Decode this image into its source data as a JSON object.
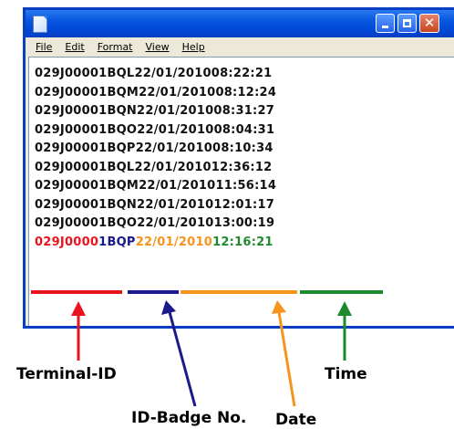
{
  "window": {
    "icon": "notepad-icon",
    "controls": [
      "minimize-icon",
      "maximize-icon",
      "close-icon"
    ]
  },
  "menu": [
    "File",
    "Edit",
    "Format",
    "View",
    "Help"
  ],
  "records": [
    "029J00001BQL22/01/201008:22:21",
    "029J00001BQM22/01/201008:12:24",
    "029J00001BQN22/01/201008:31:27",
    "029J00001BQO22/01/201008:04:31",
    "029J00001BQP22/01/201008:10:34",
    "029J00001BQL22/01/201012:36:12",
    "029J00001BQM22/01/201011:56:14",
    "029J00001BQN22/01/201012:01:17",
    "029J00001BQO22/01/201013:00:19"
  ],
  "highlighted_record": {
    "terminal_id": "029J0000",
    "badge_no": "1BQP",
    "date": "22/01/2010",
    "time": "12:16:21"
  },
  "labels": {
    "terminal_id": "Terminal-ID",
    "badge_no": "ID-Badge No.",
    "date": "Date",
    "time": "Time"
  },
  "colors": {
    "terminal_id": "#e8141e",
    "badge_no": "#1a1a8c",
    "date": "#f7941d",
    "time": "#1e8a2e"
  }
}
